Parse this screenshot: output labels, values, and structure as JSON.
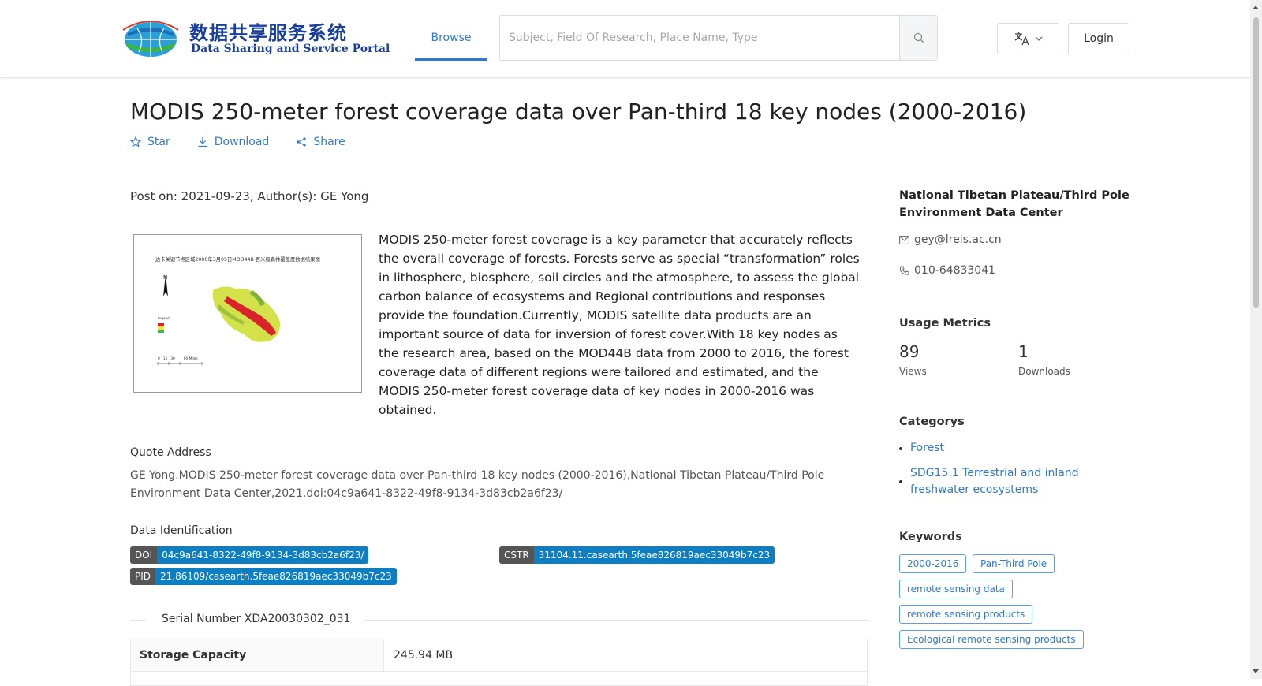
{
  "header": {
    "logo_cn": "数据共享服务系统",
    "logo_en": "Data Sharing and Service Portal",
    "nav_browse": "Browse",
    "search_placeholder": "Subject, Field Of Research, Place Name, Type",
    "search_icon": "search-icon",
    "lang_icon": "translate-icon",
    "login": "Login"
  },
  "dataset": {
    "title": "MODIS 250-meter forest coverage data over Pan-third 18 key nodes (2000-2016)",
    "actions": {
      "star": "Star",
      "download": "Download",
      "share": "Share"
    },
    "meta": "Post on: 2021-09-23, Author(s): GE Yong",
    "thumbnail": {
      "map_title": "达卡关键节点区域2000年3月05日MOD44B 百米级森林覆盖度数据结果图",
      "north": "N",
      "legend": "Legend",
      "scale": "0   15   30        60 Miles"
    },
    "description": "MODIS 250-meter forest coverage is a key parameter that accurately reflects the overall coverage of forests. Forests serve as special “transformation” roles in lithosphere, biosphere, soil circles and the atmosphere, to assess the global carbon balance of ecosystems and Regional contributions and responses provide the foundation.Currently, MODIS satellite data products are an important source of data for inversion of forest cover.With 18 key nodes as the research area, based on the MOD44B data from 2000 to 2016, the forest coverage data of different regions were tailored and estimated, and the MODIS 250-meter forest coverage data of key nodes in 2000-2016 was obtained.",
    "quote_label": "Quote Address",
    "quote": "GE Yong.MODIS 250-meter forest coverage data over Pan-third 18 key nodes (2000-2016),National Tibetan Plateau/Third Pole Environment Data Center,2021.doi:04c9a641-8322-49f8-9134-3d83cb2a6f23/",
    "ident_label": "Data Identification",
    "identifiers": {
      "doi": {
        "key": "DOI",
        "value": "04c9a641-8322-49f8-9134-3d83cb2a6f23/"
      },
      "cstr": {
        "key": "CSTR",
        "value": "31104.11.casearth.5feae826819aec33049b7c23"
      },
      "pid": {
        "key": "PID",
        "value": "21.86109/casearth.5feae826819aec33049b7c23"
      }
    },
    "serial": "Serial Number XDA20030302_031",
    "table": [
      {
        "key": "Storage Capacity",
        "value": "245.94 MB"
      }
    ]
  },
  "sidebar": {
    "org": "National Tibetan Plateau/Third Pole Environment Data Center",
    "email": "gey@lreis.ac.cn",
    "phone": "010-64833041",
    "metrics_label": "Usage Metrics",
    "views": "89",
    "views_label": "Views",
    "downloads": "1",
    "downloads_label": "Downloads",
    "categories_label": "Categorys",
    "categories": [
      "Forest",
      "SDG15.1 Terrestrial and inland freshwater ecosystems"
    ],
    "keywords_label": "Keywords",
    "keywords": [
      "2000-2016",
      "Pan-Third Pole",
      "remote sensing data",
      "remote sensing products",
      "Ecological remote sensing products"
    ]
  },
  "colors": {
    "accent": "#2f7ad1",
    "badge_key": "#555555",
    "badge_value": "#0e7ec3"
  }
}
